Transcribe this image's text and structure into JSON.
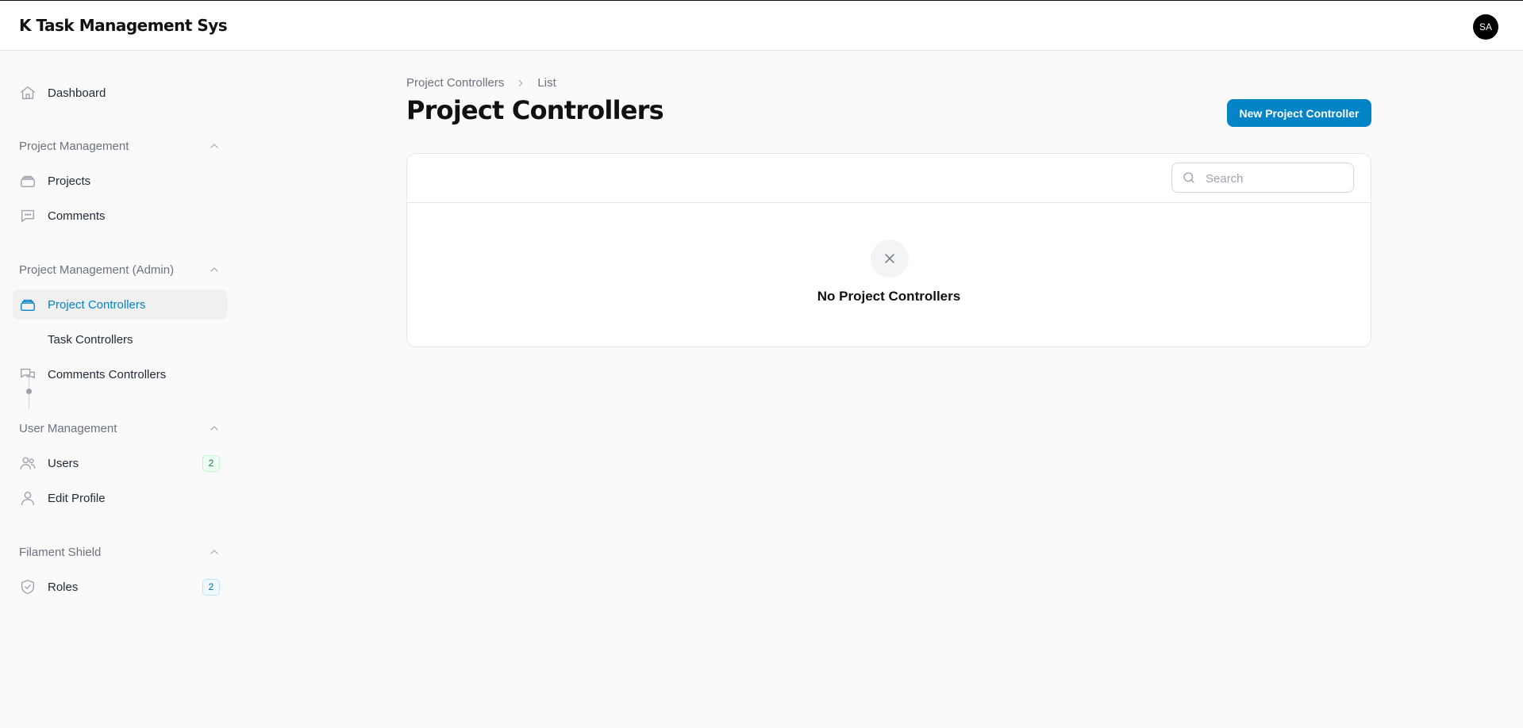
{
  "app": {
    "brand": "K Task Management Sys",
    "avatar_initials": "SA"
  },
  "sidebar": {
    "dashboard": {
      "label": "Dashboard",
      "icon": "home-icon"
    },
    "groups": [
      {
        "label": "Project Management",
        "items": [
          {
            "label": "Projects",
            "icon": "stack-icon"
          },
          {
            "label": "Comments",
            "icon": "chat-icon"
          }
        ]
      },
      {
        "label": "Project Management (Admin)",
        "items": [
          {
            "label": "Project Controllers",
            "icon": "stack-icon",
            "active": true
          },
          {
            "label": "Task Controllers",
            "icon": "dot-icon"
          },
          {
            "label": "Comments Controllers",
            "icon": "chat-bubbles-icon"
          }
        ]
      },
      {
        "label": "User Management",
        "items": [
          {
            "label": "Users",
            "icon": "users-icon",
            "badge": "2"
          },
          {
            "label": "Edit Profile",
            "icon": "user-icon"
          }
        ]
      },
      {
        "label": "Filament Shield",
        "items": [
          {
            "label": "Roles",
            "icon": "shield-check-icon",
            "badge": "2"
          }
        ]
      }
    ]
  },
  "breadcrumb": {
    "items": [
      "Project Controllers",
      "List"
    ]
  },
  "page": {
    "title": "Project Controllers",
    "new_button": "New Project Controller"
  },
  "table": {
    "search_placeholder": "Search",
    "empty_text": "No Project Controllers"
  },
  "colors": {
    "primary": "#0284c7",
    "success_badge": "#15803d",
    "info_badge": "#0369a1"
  }
}
